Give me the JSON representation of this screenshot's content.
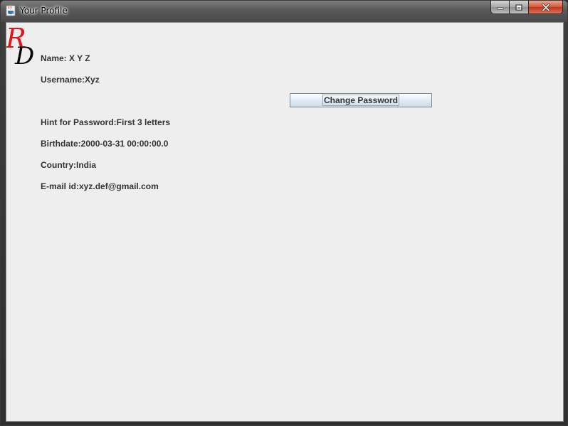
{
  "window": {
    "title": "Your Profile",
    "icon": "java-cup-icon",
    "controls": [
      "minimize-icon",
      "maximize-icon",
      "close-icon"
    ]
  },
  "logo": {
    "letters": [
      "R",
      "D"
    ],
    "colors": [
      "#e4141b",
      "#000000"
    ]
  },
  "profile": {
    "name": "Name: X Y Z",
    "username": "Username:Xyz",
    "hint": "Hint for Password:First 3 letters",
    "birthdate": "Birthdate:2000-03-31 00:00:00.0",
    "country": "Country:India",
    "email": "E-mail id:xyz.def@gmail.com"
  },
  "actions": {
    "change_password_label": "Change Password"
  }
}
